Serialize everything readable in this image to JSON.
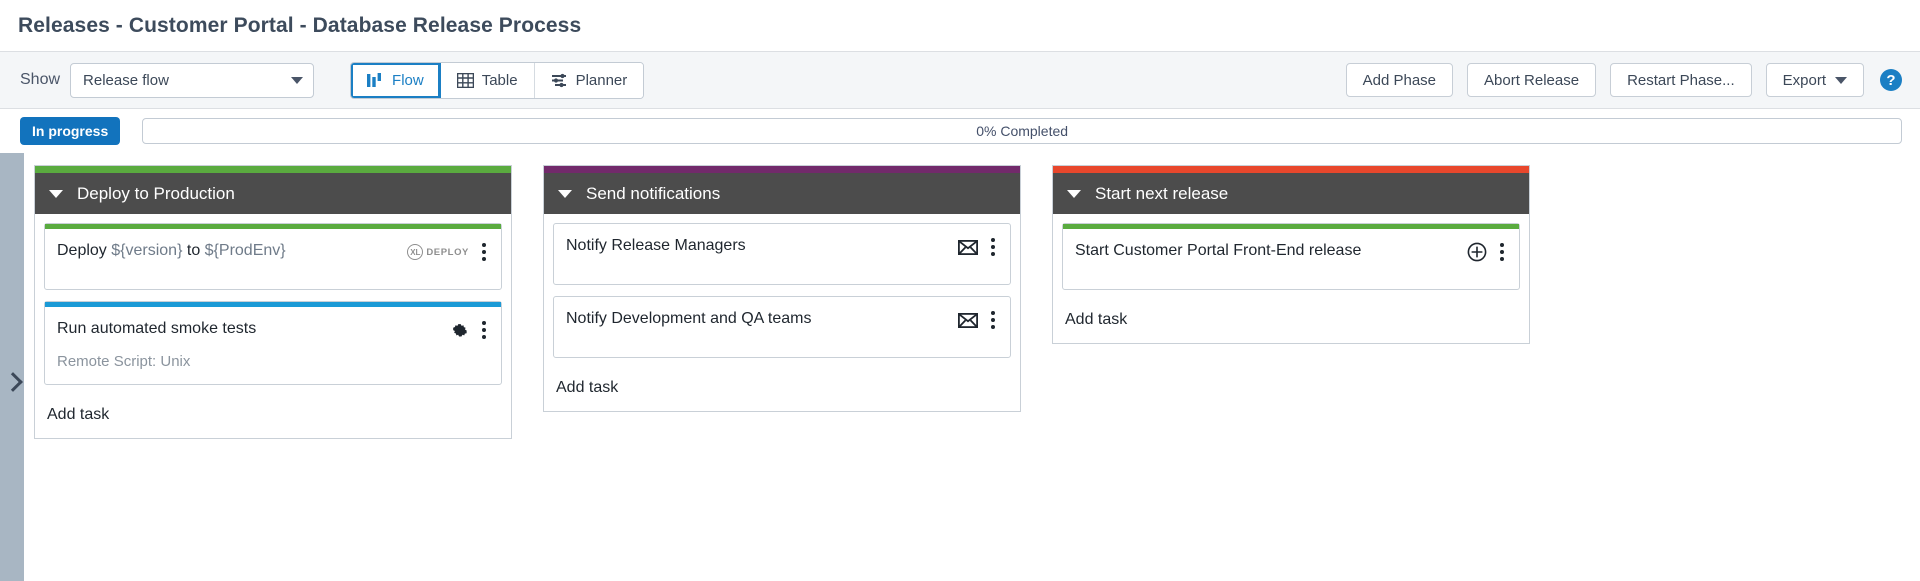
{
  "page_title": "Releases - Customer Portal - Database Release Process",
  "toolbar": {
    "show_label": "Show",
    "show_select_value": "Release flow",
    "tabs": [
      {
        "label": "Flow",
        "icon": "flow-icon",
        "active": true
      },
      {
        "label": "Table",
        "icon": "table-icon",
        "active": false
      },
      {
        "label": "Planner",
        "icon": "planner-icon",
        "active": false
      }
    ],
    "add_phase_label": "Add Phase",
    "abort_release_label": "Abort Release",
    "restart_phase_label": "Restart Phase...",
    "export_label": "Export",
    "help_label": "?"
  },
  "status": {
    "badge": "In progress",
    "badge_color": "#1273bd",
    "progress_text": "0% Completed",
    "progress_percent": 0
  },
  "board": {
    "add_task_label": "Add task",
    "phases": [
      {
        "title": "Deploy to Production",
        "accent": "#5aab3f",
        "tasks": [
          {
            "title_prefix": "Deploy ",
            "title_var1": "${version}",
            "title_mid": " to ",
            "title_var2": "${ProdEnv}",
            "subtitle": "",
            "accent": "#5aab3f",
            "icon": "xl-deploy-logo",
            "icon_text": "DEPLOY"
          },
          {
            "title_prefix": "Run automated smoke tests",
            "title_var1": "",
            "title_mid": "",
            "title_var2": "",
            "subtitle": "Remote Script: Unix",
            "accent": "#1b9ad6",
            "icon": "gear-icon",
            "icon_text": ""
          }
        ]
      },
      {
        "title": "Send notifications",
        "accent": "#722a6b",
        "tasks": [
          {
            "title_prefix": "Notify Release Managers",
            "title_var1": "",
            "title_mid": "",
            "title_var2": "",
            "subtitle": "",
            "accent": "#ffffff",
            "icon": "envelope-icon",
            "icon_text": ""
          },
          {
            "title_prefix": "Notify Development and QA teams",
            "title_var1": "",
            "title_mid": "",
            "title_var2": "",
            "subtitle": "",
            "accent": "#ffffff",
            "icon": "envelope-icon",
            "icon_text": ""
          }
        ]
      },
      {
        "title": "Start next release",
        "accent": "#e8472c",
        "tasks": [
          {
            "title_prefix": "Start Customer Portal Front-End release",
            "title_var1": "",
            "title_mid": "",
            "title_var2": "",
            "subtitle": "",
            "accent": "#5aab3f",
            "icon": "plus-circle-icon",
            "icon_text": ""
          }
        ]
      }
    ]
  }
}
